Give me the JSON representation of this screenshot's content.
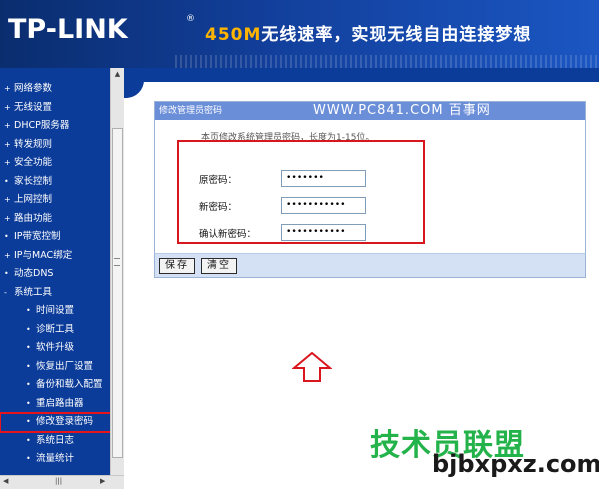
{
  "header": {
    "logo": "TP-LINK",
    "logo_reg": "®",
    "slogan_num": "450M",
    "slogan_text": "无线速率，实现无线自由连接梦想"
  },
  "sidebar": {
    "items": [
      {
        "label": "网络参数",
        "bullet": "+",
        "sub": false
      },
      {
        "label": "无线设置",
        "bullet": "+",
        "sub": false
      },
      {
        "label": "DHCP服务器",
        "bullet": "+",
        "sub": false
      },
      {
        "label": "转发规则",
        "bullet": "+",
        "sub": false
      },
      {
        "label": "安全功能",
        "bullet": "+",
        "sub": false
      },
      {
        "label": "家长控制",
        "bullet": "•",
        "sub": false
      },
      {
        "label": "上网控制",
        "bullet": "+",
        "sub": false
      },
      {
        "label": "路由功能",
        "bullet": "+",
        "sub": false
      },
      {
        "label": "IP带宽控制",
        "bullet": "•",
        "sub": false
      },
      {
        "label": "IP与MAC绑定",
        "bullet": "+",
        "sub": false
      },
      {
        "label": "动态DNS",
        "bullet": "•",
        "sub": false
      },
      {
        "label": "系统工具",
        "bullet": "-",
        "sub": false
      },
      {
        "label": "时间设置",
        "bullet": "•",
        "sub": true
      },
      {
        "label": "诊断工具",
        "bullet": "•",
        "sub": true
      },
      {
        "label": "软件升级",
        "bullet": "•",
        "sub": true
      },
      {
        "label": "恢复出厂设置",
        "bullet": "•",
        "sub": true
      },
      {
        "label": "备份和载入配置",
        "bullet": "•",
        "sub": true
      },
      {
        "label": "重启路由器",
        "bullet": "•",
        "sub": true
      },
      {
        "label": "修改登录密码",
        "bullet": "•",
        "sub": true,
        "highlighted": true
      },
      {
        "label": "系统日志",
        "bullet": "•",
        "sub": true
      },
      {
        "label": "流量统计",
        "bullet": "•",
        "sub": true
      }
    ]
  },
  "panel": {
    "title": "修改管理员密码",
    "watermark": "WWW.PC841.COM 百事网",
    "note": "本页修改系统管理员密码，长度为1-15位。",
    "fields": [
      {
        "label": "原密码：",
        "value": "•••••••"
      },
      {
        "label": "新密码：",
        "value": "•••••••••••"
      },
      {
        "label": "确认新密码：",
        "value": "•••••••••••"
      }
    ]
  },
  "buttons": {
    "save": "保存",
    "clear": "清空"
  },
  "watermark": {
    "cn": "技术员联盟",
    "en": "bjbxpxz.com"
  },
  "colors": {
    "header_bg": "#123f9b",
    "sidebar_bg": "#0c3c9a",
    "panel_title_bg": "#6b8ed8",
    "highlight_red": "#d9151d",
    "watermark_green": "#24b34a"
  }
}
